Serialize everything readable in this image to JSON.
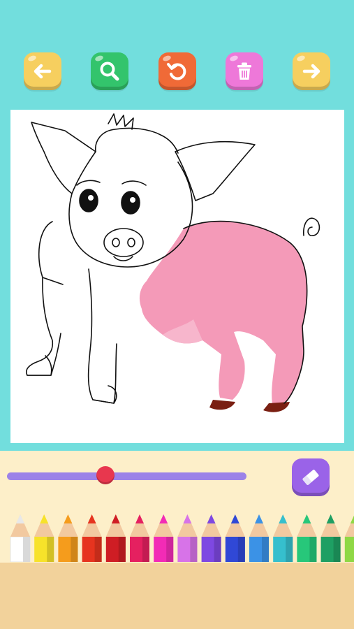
{
  "toolbar": {
    "buttons": [
      {
        "icon": "arrow-left-icon",
        "color": "#F6CF5F"
      },
      {
        "icon": "magnifier-icon",
        "color": "#33C46C"
      },
      {
        "icon": "undo-icon",
        "color": "#F06A37"
      },
      {
        "icon": "trash-icon",
        "color": "#EE78D9"
      },
      {
        "icon": "arrow-right-icon",
        "color": "#F6CF5F"
      }
    ]
  },
  "brush": {
    "size_fraction": 0.41,
    "slider_color": "#9C82E8",
    "thumb_color": "#E8374E"
  },
  "eraser": {
    "icon": "eraser-icon",
    "color": "#9A63E8"
  },
  "palette": {
    "colors": [
      "#FFFFFF",
      "#F7E22A",
      "#F59C1C",
      "#E6341F",
      "#CF1D24",
      "#E52060",
      "#F22BB6",
      "#D773E8",
      "#7E48E2",
      "#3048D6",
      "#3B92E6",
      "#36BFCD",
      "#27C77A",
      "#1E9F63",
      "#8FD845"
    ]
  },
  "artwork": {
    "subject": "pig",
    "fill_color": "#F49AB8",
    "hoof_color": "#7A1F12"
  }
}
